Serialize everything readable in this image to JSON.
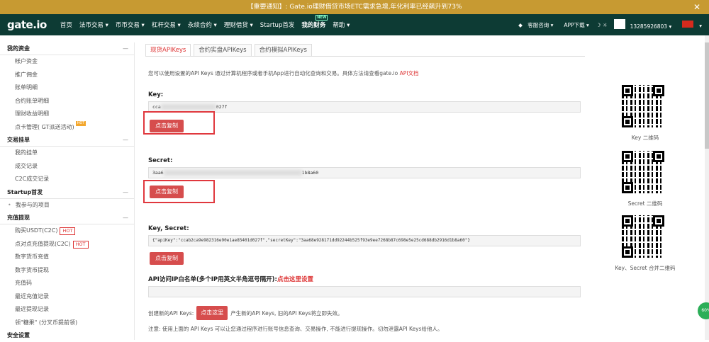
{
  "notice": {
    "text": "【重要通知】: Gate.io理财借贷市场ETC需求急增,年化利率已经飙升到73%",
    "close": "✕"
  },
  "nav": {
    "logo": "gate.io",
    "items": [
      {
        "label": "首页"
      },
      {
        "label": "法币交易 ▾"
      },
      {
        "label": "币币交易 ▾"
      },
      {
        "label": "杠杆交易 ▾"
      },
      {
        "label": "永续合约 ▾"
      },
      {
        "label": "理财借贷 ▾"
      },
      {
        "label": "Startup首发"
      },
      {
        "label": "我的财务"
      },
      {
        "label": "帮助 ▾"
      }
    ],
    "new_tag": "NEW",
    "right": {
      "service": "客服咨询 ▾",
      "app": "APP下载 ▾",
      "theme": "☽ ☼",
      "phone": "13285926803 ▾",
      "lang": "▾"
    }
  },
  "sidebar": {
    "sections": [
      {
        "title": "我的资金",
        "toggle": "—",
        "items": [
          {
            "label": "帐户资金"
          },
          {
            "label": "推广佣金"
          },
          {
            "label": "账单明细"
          },
          {
            "label": "合约账单明细"
          },
          {
            "label": "理财收益明细"
          },
          {
            "label": "点卡管理( GT派送活动)",
            "tag": "HOT"
          }
        ]
      },
      {
        "title": "交易挂单",
        "toggle": "—",
        "items": [
          {
            "label": "我的挂单"
          },
          {
            "label": "成交记录"
          },
          {
            "label": "C2C成交记录"
          }
        ]
      },
      {
        "title": "Startup首发",
        "toggle": "—",
        "items": [
          {
            "label": "我参与的项目"
          }
        ]
      },
      {
        "title": "充值提现",
        "toggle": "—",
        "items": [
          {
            "label": "购买USDT(C2C)",
            "tag": "HOT"
          },
          {
            "label": "点对点充值提现(C2C)",
            "tag": "HOT"
          },
          {
            "label": "数字货币充值"
          },
          {
            "label": "数字货币提现"
          },
          {
            "label": "充值码"
          },
          {
            "label": "最近充值记录"
          },
          {
            "label": "最近提现记录"
          },
          {
            "label": "领\"糖果\" (分叉币提前领)"
          }
        ]
      },
      {
        "title": "安全设置"
      }
    ]
  },
  "main": {
    "tabs": [
      "现货APIKeys",
      "合约实盘APIKeys",
      "合约模拟APIKeys"
    ],
    "intro": "您可以使用设置的API Keys 通过计算机程序或者手机App进行自动化查询和交易。具体方法请查看gate.io ",
    "intro_link": "API文档",
    "key_label": "Key:",
    "key_start": "cca",
    "key_end": "027f",
    "copy_btn": "点击复制",
    "secret_label": "Secret:",
    "secret_start": "3aa6",
    "secret_end": "1b8a60",
    "combo_label": "Key, Secret:",
    "combo_value": "{\"apiKey\":\"ccab2ca9e982316e90e1ae85401d027f\",\"secretKey\":\"3aa68e928171dd92244b525f93e9ee7268b87c698e5e25cd688db2916d1b8a60\"}",
    "whitelist_label": "API访问IP白名单(多个IP用英文半角逗号隔开):",
    "whitelist_link": "点击这里设置",
    "create_pre": "创建新的API Keys:",
    "create_btn": "点击这里",
    "create_post": "产生新的API Keys, 旧的API Keys将立即失效。",
    "note": "注意: 使用上面的 API Keys 可以让您通过程序进行账号信息查询、交易操作, 不能进行提现操作。切勿泄露API Keys给他人。"
  },
  "qr": {
    "key": "Key 二维码",
    "secret": "Secret 二维码",
    "combo": "Key、Secret 合并二维码"
  },
  "fab": "60%"
}
